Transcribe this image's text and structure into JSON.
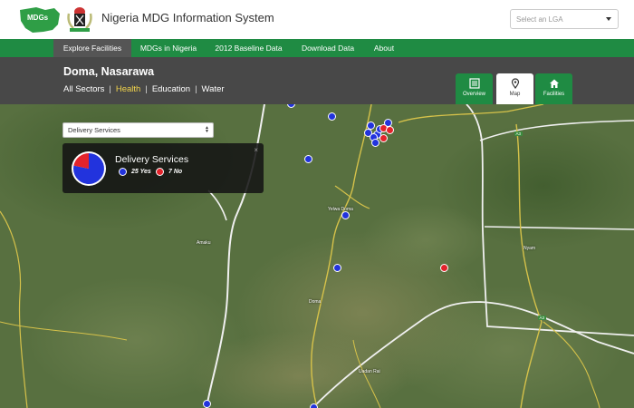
{
  "header": {
    "logo_text": "MDGs",
    "title": "Nigeria MDG Information System",
    "lga_placeholder": "Select an LGA"
  },
  "nav": {
    "items": [
      {
        "label": "Explore Facilities",
        "active": true
      },
      {
        "label": "MDGs in Nigeria",
        "active": false
      },
      {
        "label": "2012 Baseline Data",
        "active": false
      },
      {
        "label": "Download Data",
        "active": false
      },
      {
        "label": "About",
        "active": false
      }
    ]
  },
  "location": {
    "title": "Doma, Nasarawa",
    "sectors": [
      "All Sectors",
      "Health",
      "Education",
      "Water"
    ],
    "active_sector": "Health",
    "separator": "|"
  },
  "views": [
    {
      "label": "Overview",
      "icon": "list-icon"
    },
    {
      "label": "Map",
      "icon": "map-pin-icon",
      "active": true
    },
    {
      "label": "Facilities",
      "icon": "home-icon"
    }
  ],
  "map": {
    "service_select": "Delivery Services",
    "labels": [
      "Yelwa Doma",
      "Amaku",
      "Doma",
      "Uadan Rai",
      "Nyam"
    ],
    "road_badges": [
      "A3",
      "A3"
    ],
    "panel": {
      "title": "Delivery Services",
      "yes_label": "25 Yes",
      "no_label": "7 No",
      "yes_count": 25,
      "no_count": 7,
      "yes_color": "#2233dd",
      "no_color": "#e3232b",
      "close": "×"
    }
  }
}
